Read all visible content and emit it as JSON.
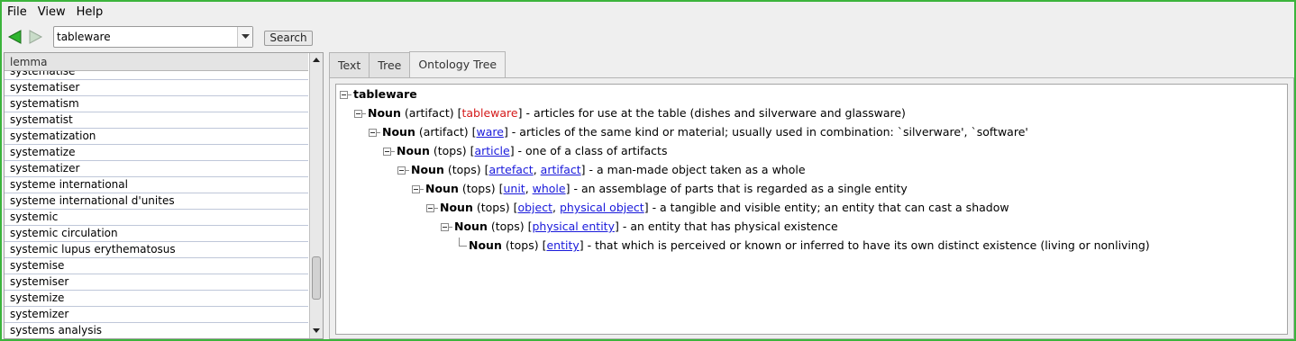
{
  "menu": [
    "File",
    "View",
    "Help"
  ],
  "toolbar": {
    "search_value": "tableware",
    "search_button": "Search"
  },
  "list": {
    "header": "lemma",
    "items": [
      "systematise",
      "systematiser",
      "systematism",
      "systematist",
      "systematization",
      "systematize",
      "systematizer",
      "systeme international",
      "systeme international d'unites",
      "systemic",
      "systemic circulation",
      "systemic lupus erythematosus",
      "systemise",
      "systemiser",
      "systemize",
      "systemizer",
      "systems analysis"
    ]
  },
  "tabs": [
    "Text",
    "Tree",
    "Ontology Tree"
  ],
  "active_tab": "Ontology Tree",
  "tree": {
    "root": "tableware",
    "nodes": [
      {
        "pos": "Noun",
        "category": "(artifact)",
        "pre": "[",
        "words": [
          {
            "text": "tableware",
            "style": "current"
          }
        ],
        "post": "]",
        "gloss": " - articles for use at the table (dishes and silverware and glassware)"
      },
      {
        "pos": "Noun",
        "category": "(artifact)",
        "pre": "[",
        "words": [
          {
            "text": "ware",
            "style": "link"
          }
        ],
        "post": "]",
        "gloss": " - articles of the same kind or material; usually used in combination: `silverware', `software'"
      },
      {
        "pos": "Noun",
        "category": "(tops)",
        "pre": "[",
        "words": [
          {
            "text": "article",
            "style": "link"
          }
        ],
        "post": "]",
        "gloss": " - one of a class of artifacts"
      },
      {
        "pos": "Noun",
        "category": "(tops)",
        "pre": "[",
        "words": [
          {
            "text": "artefact",
            "style": "link"
          },
          {
            "text": "artifact",
            "style": "link"
          }
        ],
        "post": "]",
        "gloss": " - a man-made object taken as a whole"
      },
      {
        "pos": "Noun",
        "category": "(tops)",
        "pre": "[",
        "words": [
          {
            "text": "unit",
            "style": "link"
          },
          {
            "text": "whole",
            "style": "link"
          }
        ],
        "post": "]",
        "gloss": " - an assemblage of parts that is regarded as a single entity"
      },
      {
        "pos": "Noun",
        "category": "(tops)",
        "pre": "[",
        "words": [
          {
            "text": "object",
            "style": "link"
          },
          {
            "text": "physical object",
            "style": "link"
          }
        ],
        "post": "]",
        "gloss": " - a tangible and visible entity; an entity that can cast a shadow"
      },
      {
        "pos": "Noun",
        "category": "(tops)",
        "pre": "[",
        "words": [
          {
            "text": "physical entity",
            "style": "link"
          }
        ],
        "post": "]",
        "gloss": " - an entity that has physical existence"
      },
      {
        "pos": "Noun",
        "category": "(tops)",
        "pre": "[",
        "words": [
          {
            "text": "entity",
            "style": "link"
          }
        ],
        "post": "]",
        "gloss": " - that which is perceived or known or inferred to have its own distinct existence (living or nonliving)",
        "leaf": true
      }
    ]
  },
  "colors": {
    "window_border": "#3cb43c",
    "link": "#1a1adb",
    "current_word": "#d41a1a",
    "nav_arrow_active": "#2fb52f",
    "nav_arrow_inactive": "#a8c8a8"
  }
}
